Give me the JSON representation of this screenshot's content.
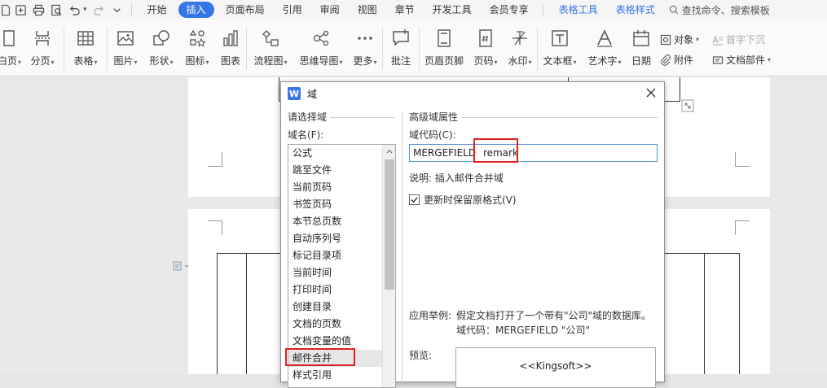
{
  "menubar": {
    "items": [
      "开始",
      "插入",
      "页面布局",
      "引用",
      "审阅",
      "视图",
      "章节",
      "开发工具",
      "会员专享"
    ],
    "active": "插入",
    "context_tabs": [
      "表格工具",
      "表格样式"
    ],
    "search": "查找命令、搜索模板",
    "dropdown_glyph": "▾"
  },
  "ribbon": {
    "buttons": {
      "page": "白页",
      "break": "分页",
      "table": "表格",
      "picture": "图片",
      "shape": "形状",
      "icons": "图标",
      "chart": "图表",
      "flowchart": "流程图",
      "mindmap": "思维导图",
      "more": "更多",
      "comment": "批注",
      "header_footer": "页眉页脚",
      "page_number": "页码",
      "watermark": "水印",
      "textbox": "文本框",
      "wordart": "艺术字",
      "date": "日期"
    },
    "small": {
      "object": "对象",
      "dropcap": "首字下沉",
      "attachment": "附件",
      "doc_part": "文档部件"
    }
  },
  "dialog": {
    "title": "域",
    "left_group": "请选择域",
    "field_name_label": "域名(F):",
    "field_list": [
      "公式",
      "跳至文件",
      "当前页码",
      "书签页码",
      "本节总页数",
      "自动序列号",
      "标记目录项",
      "当前时间",
      "打印时间",
      "创建目录",
      "文档的页数",
      "文档变量的值",
      "邮件合并",
      "样式引用"
    ],
    "selected_field": "邮件合并",
    "right_group": "高级域属性",
    "code_label": "域代码(C):",
    "code_keyword": "MERGEFIELD",
    "code_value": "remark",
    "description": "说明: 插入邮件合并域",
    "keep_format_label": "更新时保留原格式(V)",
    "keep_format_checked": true,
    "example_label": "应用举例:",
    "example_line1": "假定文档打开了一个带有\"公司\"域的数据库。",
    "example_line2": "域代码：MERGEFIELD \"公司\"",
    "preview_label": "预览:",
    "preview_text": "<<Kingsoft>>"
  },
  "colors": {
    "accent": "#3575e6",
    "highlight": "#e02020"
  }
}
